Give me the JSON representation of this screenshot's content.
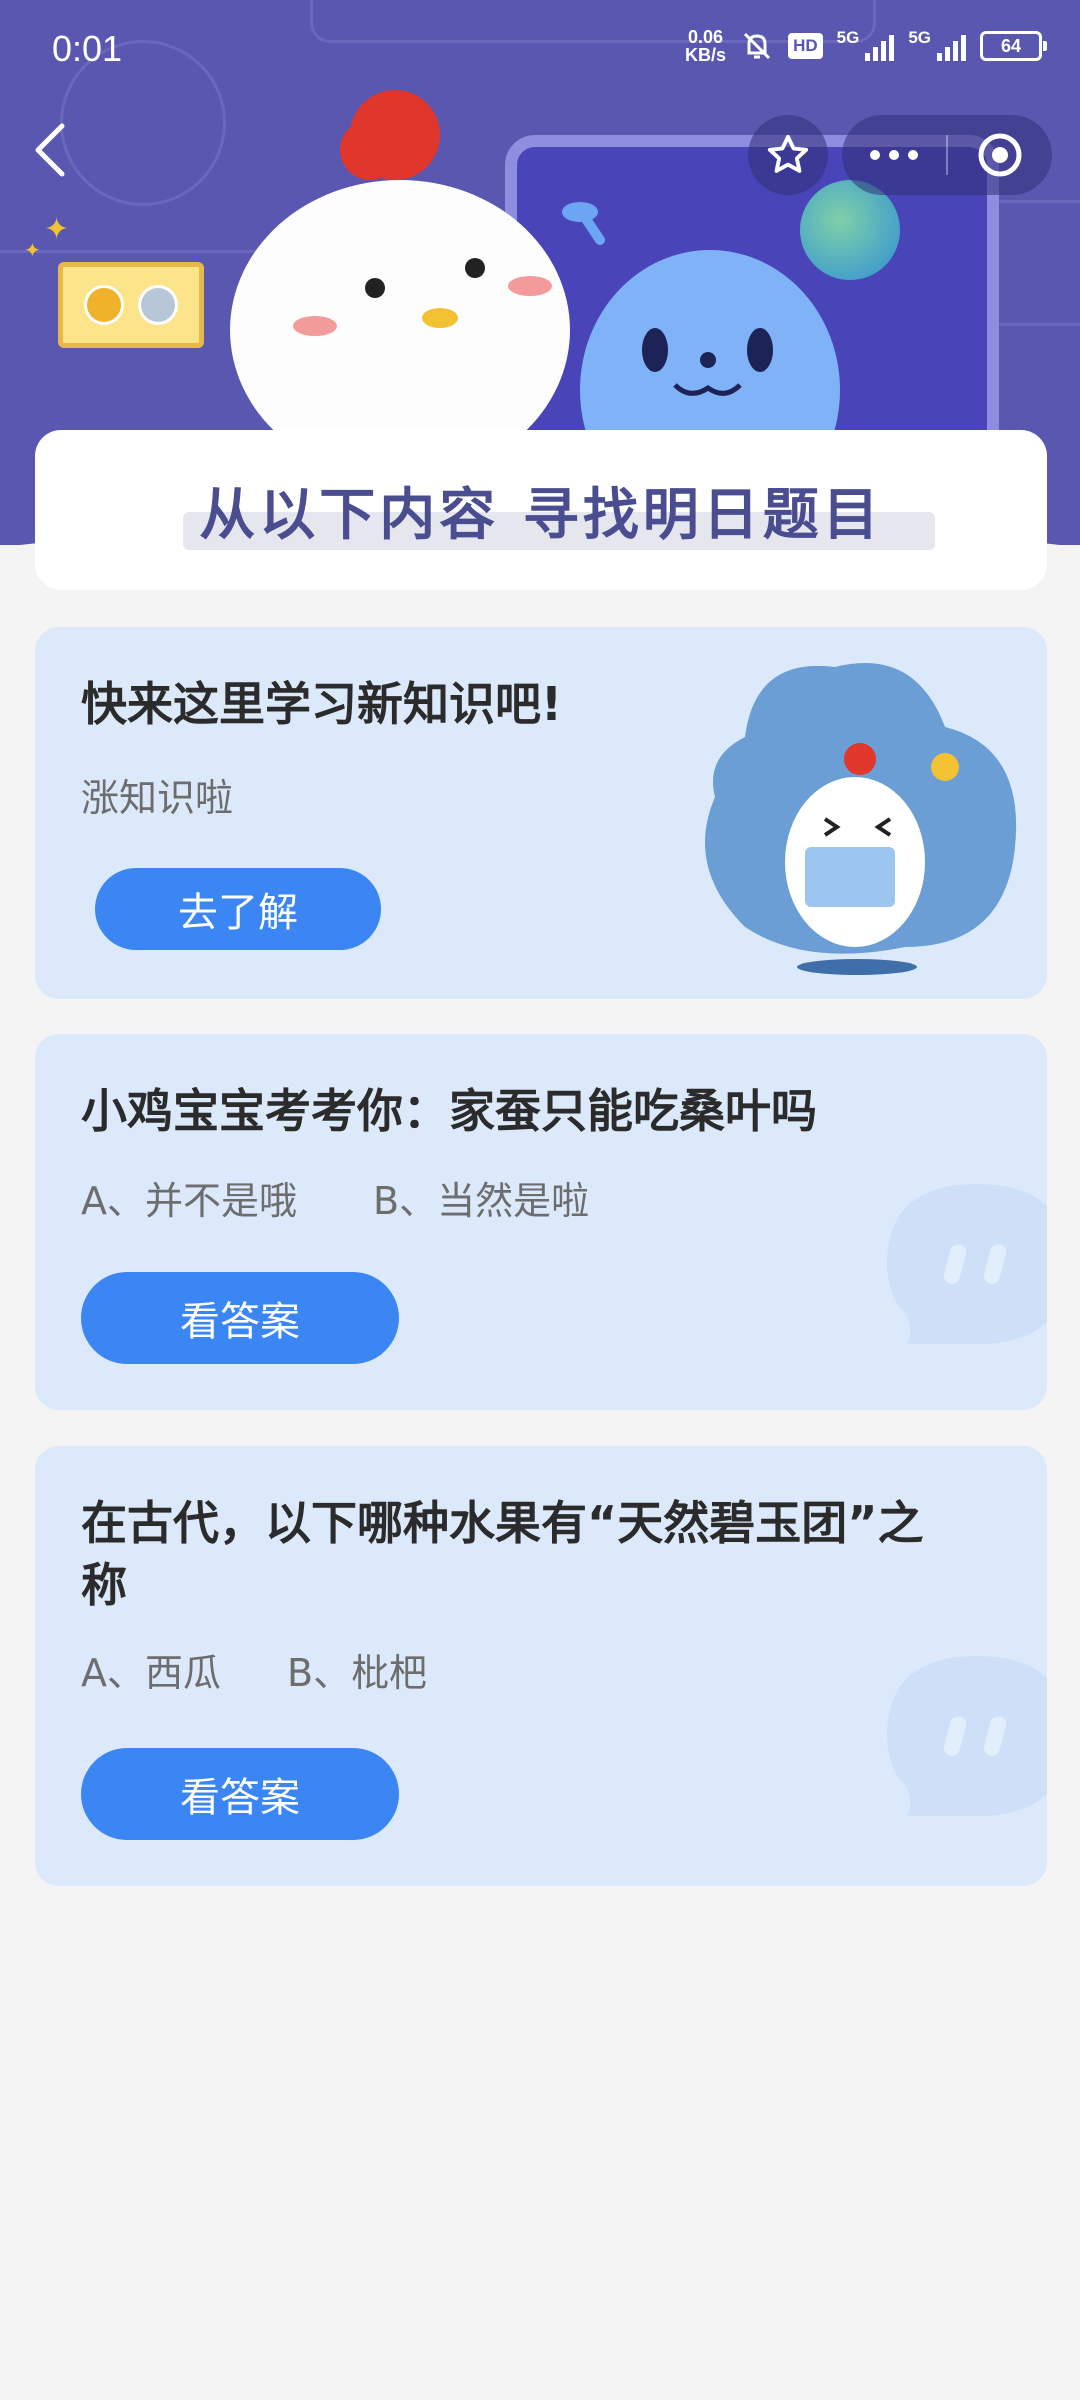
{
  "status_bar": {
    "time": "0:01",
    "net_speed_value": "0.06",
    "net_speed_unit": "KB/s",
    "hd_label": "HD",
    "sim1_label": "5G",
    "sim2_label": "5G",
    "battery": "64"
  },
  "banner": {
    "title": "从以下内容  寻找明日题目"
  },
  "learn_card": {
    "title": "快来这里学习新知识吧!",
    "subtitle": "涨知识啦",
    "button_label": "去了解"
  },
  "questions": [
    {
      "title": "小鸡宝宝考考你：家蚕只能吃桑叶吗",
      "option_a": "A、并不是哦",
      "option_b": "B、当然是啦",
      "button_label": "看答案"
    },
    {
      "title": "在古代，以下哪种水果有“天然碧玉团”之称",
      "option_a": "A、西瓜",
      "option_b": "B、枇杷",
      "button_label": "看答案"
    }
  ],
  "colors": {
    "header_bg": "#5a57b0",
    "card_bg": "#dce9fb",
    "button_blue": "#3b86f3",
    "banner_text": "#4a4d8f"
  }
}
